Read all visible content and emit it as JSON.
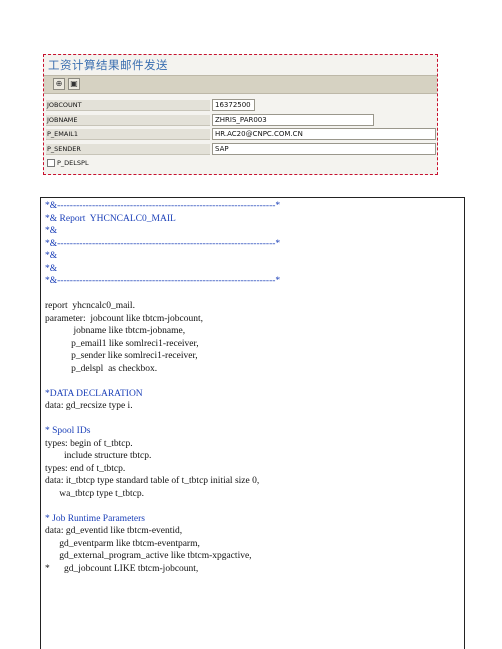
{
  "selection_screen": {
    "title": "工资计算结果邮件发送",
    "toolbar": [
      {
        "name": "execute-icon",
        "glyph": "⊕"
      },
      {
        "name": "get-variant-icon",
        "glyph": "▣"
      }
    ],
    "fields": [
      {
        "label": "JOBCOUNT",
        "value": "16372500"
      },
      {
        "label": "JOBNAME",
        "value": "ZHRIS_PAR003"
      },
      {
        "label": "P_EMAIL1",
        "value": "HR.AC20@CNPC.COM.CN"
      },
      {
        "label": "P_SENDER",
        "value": "SAP"
      }
    ],
    "checkbox": {
      "label": "P_DELSPL",
      "checked": false
    }
  },
  "code": {
    "lines": [
      {
        "text": "*&---------------------------------------------------------------------*",
        "comment": true
      },
      {
        "text": "*& Report  YHCNCALC0_MAIL",
        "comment": true
      },
      {
        "text": "*&",
        "comment": true
      },
      {
        "text": "*&---------------------------------------------------------------------*",
        "comment": true
      },
      {
        "text": "*&",
        "comment": true
      },
      {
        "text": "*&",
        "comment": true
      },
      {
        "text": "*&---------------------------------------------------------------------*",
        "comment": true
      },
      {
        "text": "",
        "comment": false
      },
      {
        "text": "report  yhcncalc0_mail.",
        "comment": false
      },
      {
        "text": "parameter:  jobcount like tbtcm-jobcount,",
        "comment": false
      },
      {
        "text": "            jobname like tbtcm-jobname,",
        "comment": false
      },
      {
        "text": "           p_email1 like somlreci1-receiver,",
        "comment": false
      },
      {
        "text": "           p_sender like somlreci1-receiver,",
        "comment": false
      },
      {
        "text": "           p_delspl  as checkbox.",
        "comment": false
      },
      {
        "text": "",
        "comment": false
      },
      {
        "text": "*DATA DECLARATION",
        "comment": true
      },
      {
        "text": "data: gd_recsize type i.",
        "comment": false
      },
      {
        "text": "",
        "comment": false
      },
      {
        "text": "* Spool IDs",
        "comment": true
      },
      {
        "text": "types: begin of t_tbtcp.",
        "comment": false
      },
      {
        "text": "        include structure tbtcp.",
        "comment": false
      },
      {
        "text": "types: end of t_tbtcp.",
        "comment": false
      },
      {
        "text": "data: it_tbtcp type standard table of t_tbtcp initial size 0,",
        "comment": false
      },
      {
        "text": "      wa_tbtcp type t_tbtcp.",
        "comment": false
      },
      {
        "text": "",
        "comment": false
      },
      {
        "text": "* Job Runtime Parameters",
        "comment": true
      },
      {
        "text": "data: gd_eventid like tbtcm-eventid,",
        "comment": false
      },
      {
        "text": "      gd_eventparm like tbtcm-eventparm,",
        "comment": false
      },
      {
        "text": "      gd_external_program_active like tbtcm-xpgactive,",
        "comment": false
      },
      {
        "text": "*      gd_jobcount LIKE tbtcm-jobcount,",
        "comment": false
      }
    ]
  }
}
